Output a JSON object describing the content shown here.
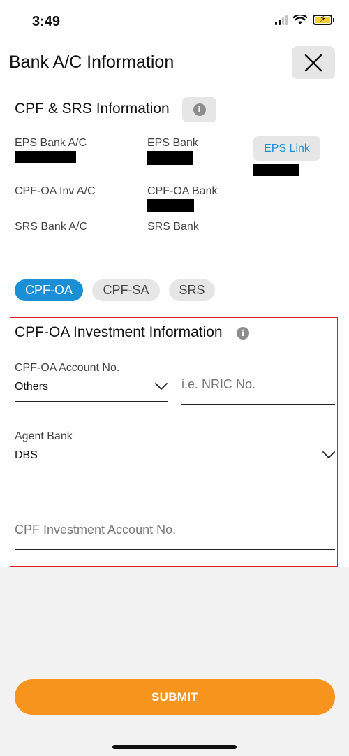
{
  "status_bar": {
    "time": "3:49"
  },
  "header": {
    "title": "Bank A/C Information"
  },
  "cpf_srs": {
    "section_title": "CPF & SRS Information",
    "eps_bank_ac_label": "EPS Bank A/C",
    "eps_bank_label": "EPS Bank",
    "eps_link_label": "EPS Link",
    "cpf_oa_inv_ac_label": "CPF-OA Inv A/C",
    "cpf_oa_bank_label": "CPF-OA Bank",
    "srs_bank_ac_label": "SRS Bank A/C",
    "srs_bank_label": "SRS Bank"
  },
  "tabs": [
    {
      "label": "CPF-OA",
      "active": true
    },
    {
      "label": "CPF-SA",
      "active": false
    },
    {
      "label": "SRS",
      "active": false
    }
  ],
  "investment": {
    "title": "CPF-OA Investment Information",
    "account_no_label": "CPF-OA Account No.",
    "account_no_value": "Others",
    "nric_placeholder": "i.e. NRIC No.",
    "agent_bank_label": "Agent Bank",
    "agent_bank_value": "DBS",
    "cpf_inv_account_placeholder": "CPF Investment Account No."
  },
  "footer": {
    "submit_label": "SUBMIT"
  },
  "colors": {
    "accent_blue": "#1a8fd6",
    "submit_orange": "#f7941d",
    "highlight_red": "#d81f26"
  }
}
